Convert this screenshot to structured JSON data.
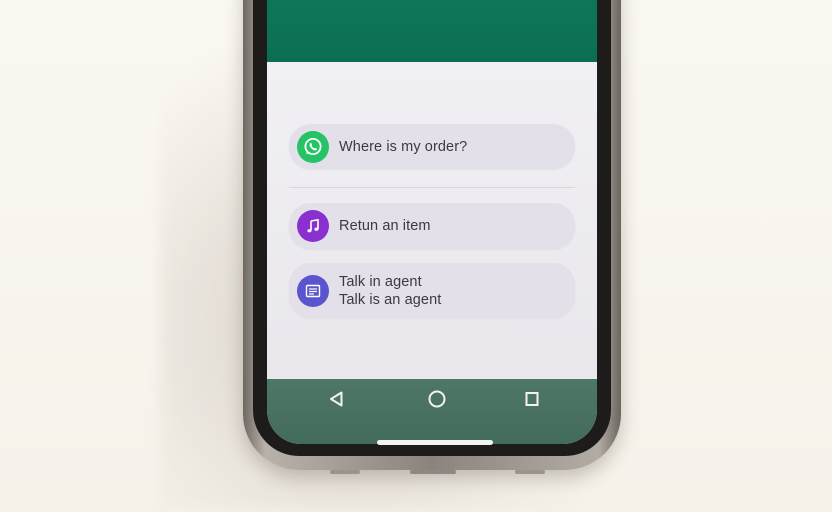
{
  "chat_options": [
    {
      "label": "Where is my order?",
      "icon": "whatsapp-icon",
      "color": "#25c266"
    },
    {
      "label": "Retun an item",
      "icon": "music-note-icon",
      "color": "#8a2fd0"
    },
    {
      "label_line1": "Talk in agent",
      "label_line2": "Talk is an agent",
      "icon": "document-icon",
      "color": "#5a55cf"
    }
  ],
  "nav_bar": {
    "back": "back-icon",
    "home": "home-icon",
    "recents": "recents-icon"
  },
  "colors": {
    "header": "#0e7a5c",
    "nav_bar": "#4a7262",
    "option_bg": "#e3e0e9"
  }
}
